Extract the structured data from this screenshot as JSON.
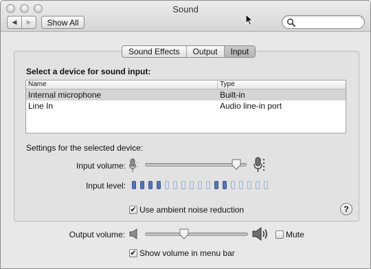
{
  "window": {
    "title": "Sound"
  },
  "toolbar": {
    "back_icon": "◀",
    "forward_icon": "▶",
    "show_all_label": "Show All"
  },
  "search": {
    "value": "",
    "placeholder": ""
  },
  "tabs": [
    {
      "label": "Sound Effects",
      "active": false
    },
    {
      "label": "Output",
      "active": false
    },
    {
      "label": "Input",
      "active": true
    }
  ],
  "input": {
    "section_title": "Select a device for sound input:",
    "columns": {
      "name": "Name",
      "type": "Type"
    },
    "devices": [
      {
        "name": "Internal microphone",
        "type": "Built-in",
        "selected": true
      },
      {
        "name": "Line In",
        "type": "Audio line-in port",
        "selected": false
      }
    ],
    "settings_label": "Settings for the selected device:",
    "input_volume_label": "Input volume:",
    "input_volume_fraction": 0.9,
    "input_level_label": "Input level:",
    "input_level_segments": [
      1,
      1,
      1,
      1,
      0,
      0,
      0,
      0,
      0,
      0,
      1,
      1,
      0,
      0,
      0,
      0,
      0
    ],
    "ambient_label": "Use ambient noise reduction",
    "ambient_checked": true,
    "help_label": "?"
  },
  "output": {
    "volume_label": "Output volume:",
    "volume_fraction": 0.38,
    "mute_label": "Mute",
    "mute_checked": false,
    "menu_bar_label": "Show volume in menu bar",
    "menu_bar_checked": true
  },
  "colors": {
    "level_on": "#5677b8",
    "level_off": "#d9e2ee",
    "selected_row": "#d4d4d4"
  }
}
